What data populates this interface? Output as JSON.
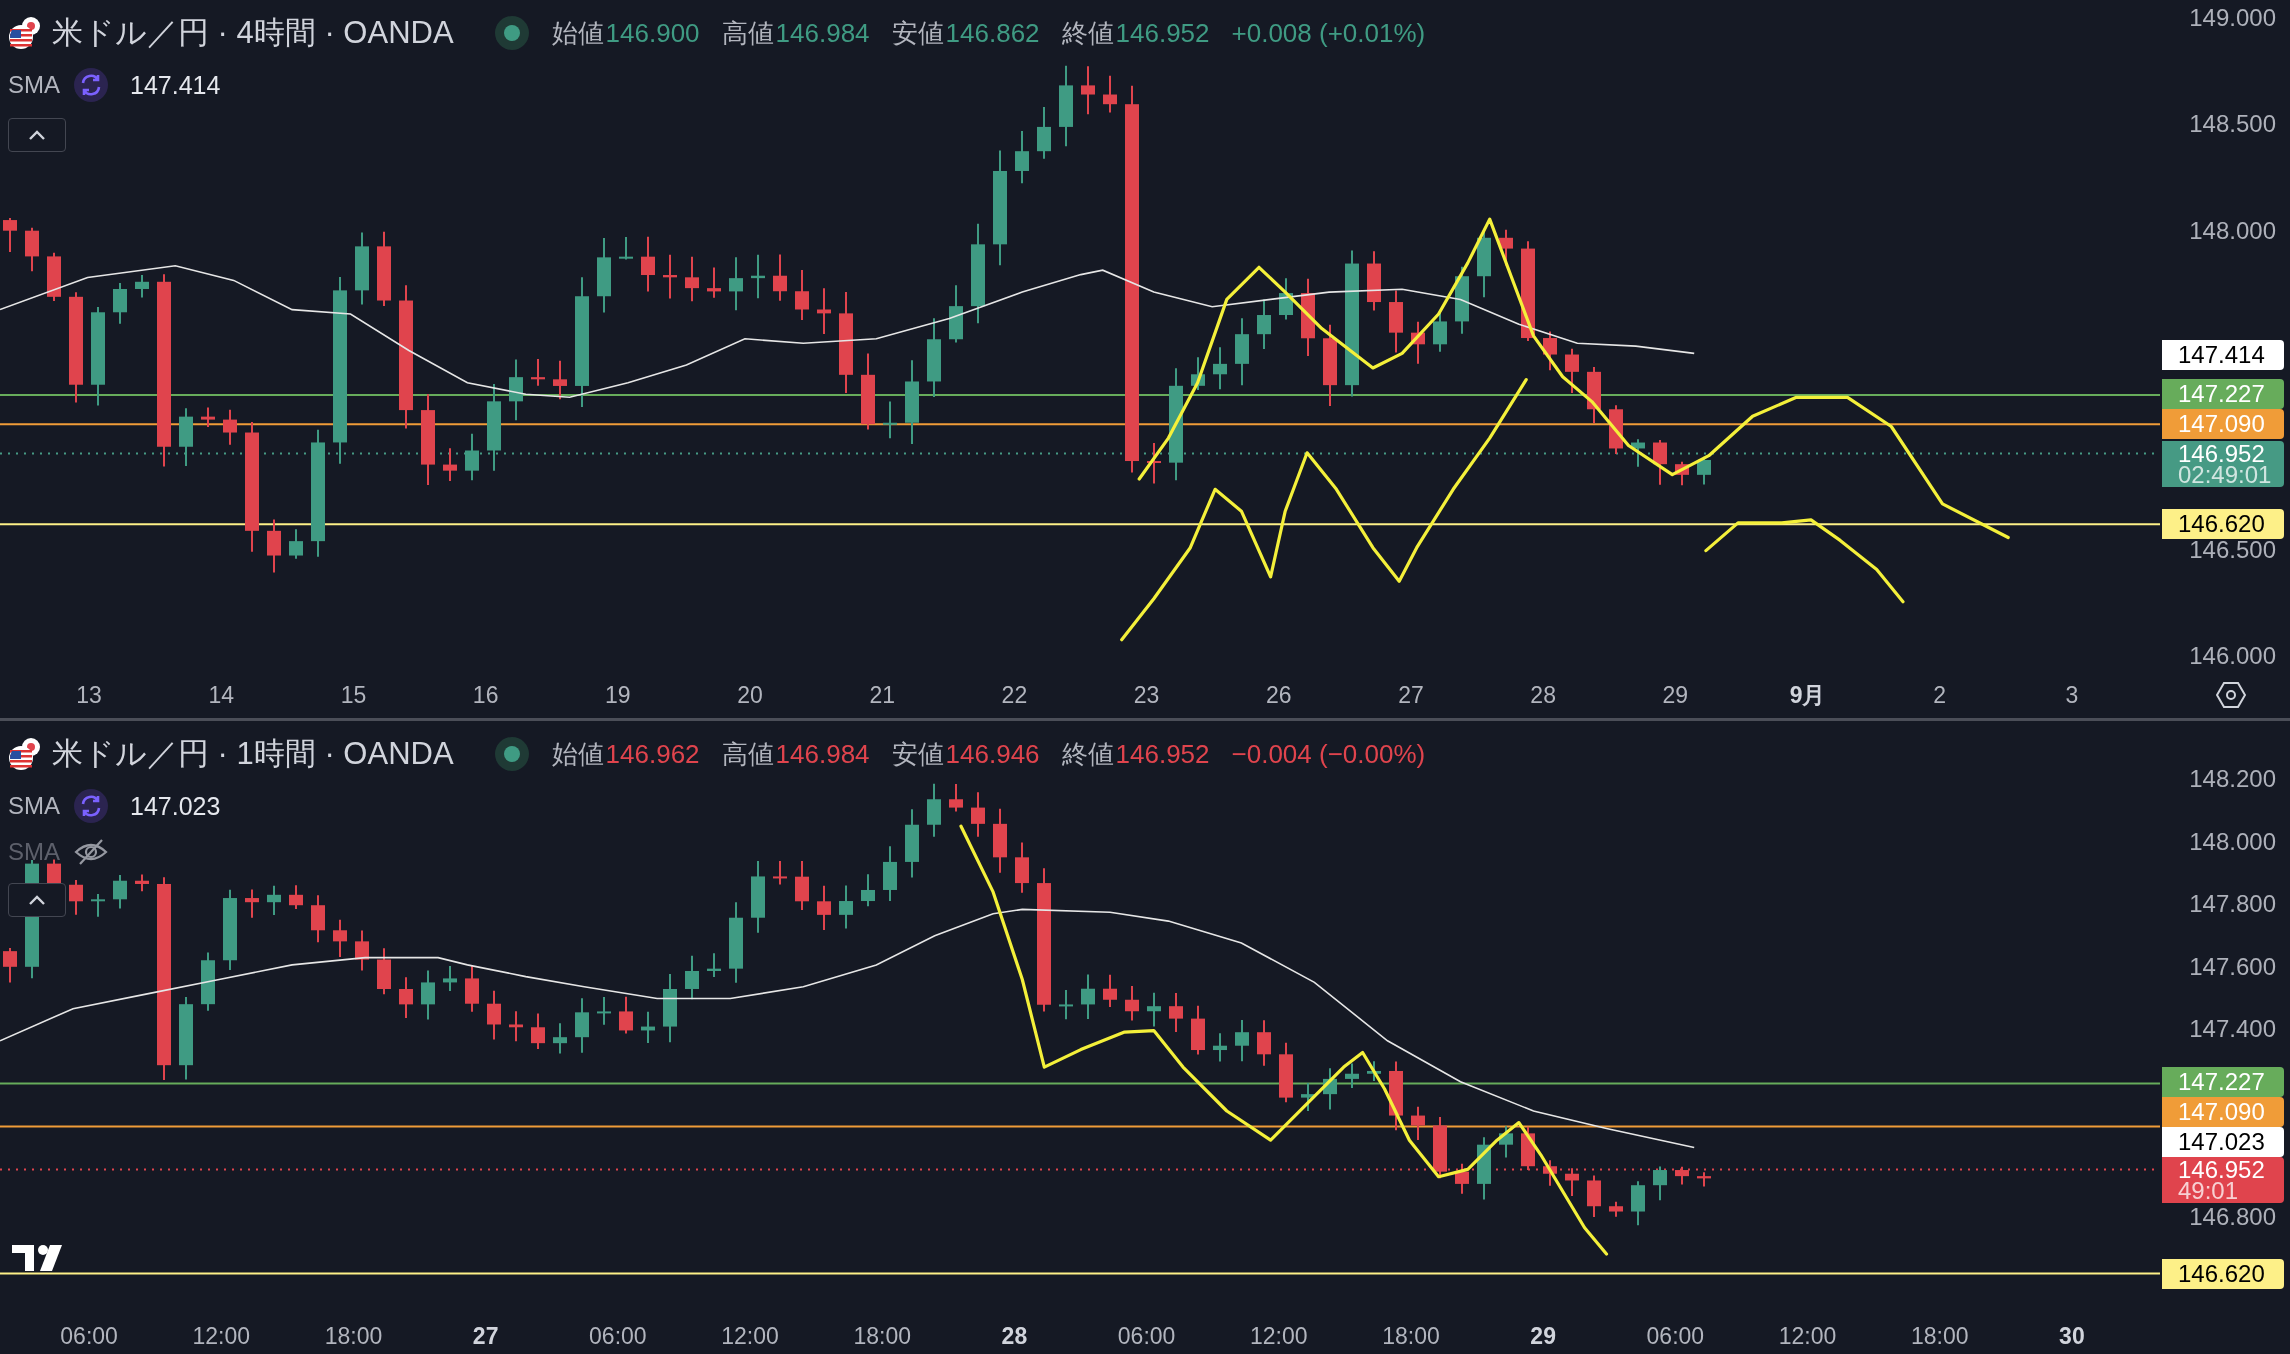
{
  "panes": [
    {
      "symbol": {
        "title": "米ドル／円 · 4時間 · OANDA",
        "market_open": true
      },
      "ohlc": [
        {
          "label": "始値",
          "value": "146.900"
        },
        {
          "label": "高値",
          "value": "146.984"
        },
        {
          "label": "安値",
          "value": "146.862"
        },
        {
          "label": "終値",
          "value": "146.952"
        }
      ],
      "change": "+0.008 (+0.01%)",
      "rising": true,
      "indicators": [
        {
          "name": "SMA",
          "value": "147.414",
          "hidden": false
        }
      ],
      "price_axis": [
        "149.000",
        "148.500",
        "148.000",
        "146.500",
        "146.000"
      ],
      "price_labels": [
        {
          "kind": "sma",
          "text": "147.414",
          "color": "#ffffff"
        },
        {
          "kind": "level",
          "text": "147.227",
          "color": "#67ac5b"
        },
        {
          "kind": "level",
          "text": "147.090",
          "color": "#f09c38"
        },
        {
          "kind": "last",
          "text": "146.952",
          "countdown": "02:49:01",
          "color": "#469a84"
        },
        {
          "kind": "level",
          "text": "146.620",
          "color": "#fdf088"
        }
      ],
      "time_axis": [
        {
          "label": "13",
          "bold": false
        },
        {
          "label": "14",
          "bold": false
        },
        {
          "label": "15",
          "bold": false
        },
        {
          "label": "16",
          "bold": false
        },
        {
          "label": "19",
          "bold": false
        },
        {
          "label": "20",
          "bold": false
        },
        {
          "label": "21",
          "bold": false
        },
        {
          "label": "22",
          "bold": false
        },
        {
          "label": "23",
          "bold": false
        },
        {
          "label": "26",
          "bold": false
        },
        {
          "label": "27",
          "bold": false
        },
        {
          "label": "28",
          "bold": false
        },
        {
          "label": "29",
          "bold": false
        },
        {
          "label": "9月",
          "bold": true
        },
        {
          "label": "2",
          "bold": false
        },
        {
          "label": "3",
          "bold": false
        }
      ]
    },
    {
      "symbol": {
        "title": "米ドル／円 · 1時間 · OANDA",
        "market_open": true
      },
      "ohlc": [
        {
          "label": "始値",
          "value": "146.962"
        },
        {
          "label": "高値",
          "value": "146.984"
        },
        {
          "label": "安値",
          "value": "146.946"
        },
        {
          "label": "終値",
          "value": "146.952"
        }
      ],
      "change": "−0.004 (−0.00%)",
      "rising": false,
      "indicators": [
        {
          "name": "SMA",
          "value": "147.023",
          "hidden": false
        },
        {
          "name": "SMA",
          "hidden": true
        }
      ],
      "price_axis": [
        "148.200",
        "148.000",
        "147.800",
        "147.600",
        "147.400",
        "146.800"
      ],
      "price_labels": [
        {
          "kind": "level",
          "text": "147.227",
          "color": "#67ac5b"
        },
        {
          "kind": "level",
          "text": "147.090",
          "color": "#f09c38"
        },
        {
          "kind": "sma",
          "text": "147.023",
          "color": "#ffffff"
        },
        {
          "kind": "last",
          "text": "146.952",
          "countdown": "49:01",
          "color": "#e0444d"
        },
        {
          "kind": "level",
          "text": "146.620",
          "color": "#fdf088"
        }
      ],
      "time_axis": [
        {
          "label": "06:00",
          "bold": false
        },
        {
          "label": "12:00",
          "bold": false
        },
        {
          "label": "18:00",
          "bold": false
        },
        {
          "label": "27",
          "bold": true
        },
        {
          "label": "06:00",
          "bold": false
        },
        {
          "label": "12:00",
          "bold": false
        },
        {
          "label": "18:00",
          "bold": false
        },
        {
          "label": "28",
          "bold": true
        },
        {
          "label": "06:00",
          "bold": false
        },
        {
          "label": "12:00",
          "bold": false
        },
        {
          "label": "18:00",
          "bold": false
        },
        {
          "label": "29",
          "bold": true
        },
        {
          "label": "06:00",
          "bold": false
        },
        {
          "label": "12:00",
          "bold": false
        },
        {
          "label": "18:00",
          "bold": false
        },
        {
          "label": "30",
          "bold": true
        }
      ]
    }
  ]
}
